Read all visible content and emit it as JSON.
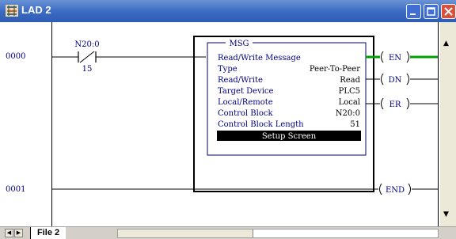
{
  "window": {
    "title": "LAD 2"
  },
  "rungs": [
    {
      "number": "0000"
    },
    {
      "number": "0001"
    }
  ],
  "contact": {
    "address": "N20:0",
    "bit": "15"
  },
  "msg": {
    "title": "MSG",
    "header": "Read/Write Message",
    "rows": [
      {
        "label": "Type",
        "value": "Peer-To-Peer"
      },
      {
        "label": "Read/Write",
        "value": "Read"
      },
      {
        "label": "Target Device",
        "value": "PLC5"
      },
      {
        "label": "Local/Remote",
        "value": "Local"
      },
      {
        "label": "Control Block",
        "value": "N20:0"
      },
      {
        "label": "Control Block Length",
        "value": "51"
      }
    ],
    "setup_button": "Setup Screen"
  },
  "coils": {
    "en": "EN",
    "dn": "DN",
    "er": "ER",
    "end": "END"
  },
  "tabs": {
    "file_tab": "File 2"
  },
  "colors": {
    "text": "#000080",
    "title_bar": "#3d6cc4",
    "en_highlight": "#00a000"
  }
}
